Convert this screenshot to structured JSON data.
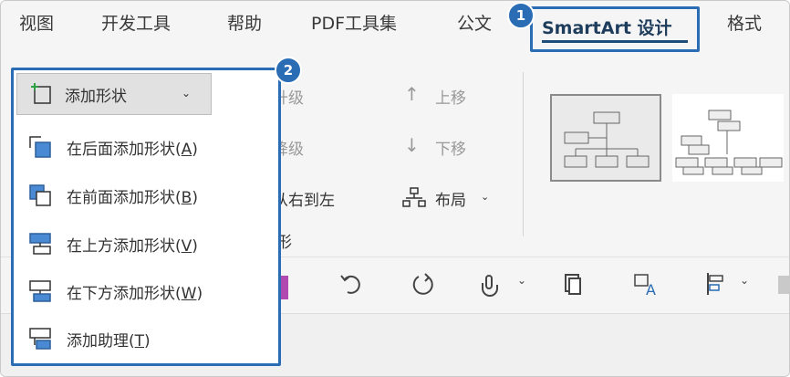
{
  "menu_tabs": {
    "view": "视图",
    "developer": "开发工具",
    "help": "帮助",
    "pdf_tools": "PDF工具集",
    "official": "公文",
    "smartart_design": "SmartArt 设计",
    "format": "格式"
  },
  "callouts": {
    "first": "1",
    "second": "2"
  },
  "ribbon": {
    "promote": "升级",
    "demote": "降级",
    "right_to_left": "从右到左",
    "move_up": "上移",
    "move_down": "下移",
    "layout": "布局",
    "group_label_fragment": "形"
  },
  "add_shape": {
    "button_label": "添加形状",
    "items": [
      {
        "label": "在后面添加形状",
        "key": "A"
      },
      {
        "label": "在前面添加形状",
        "key": "B"
      },
      {
        "label": "在上方添加形状",
        "key": "V"
      },
      {
        "label": "在下方添加形状",
        "key": "W"
      },
      {
        "label": "添加助理",
        "key": "T"
      }
    ]
  },
  "colors": {
    "highlight": "#2a6db5",
    "icon_blue": "#4a8ad4",
    "tab_text_active": "#1e3d5c"
  }
}
